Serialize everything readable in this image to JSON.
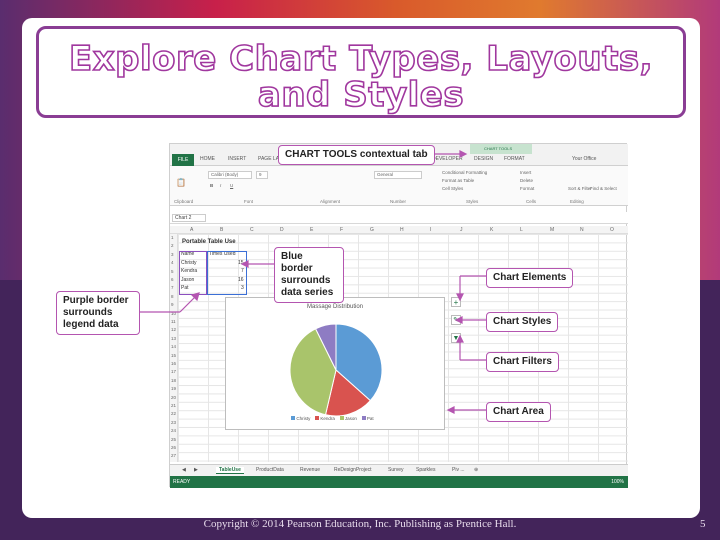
{
  "slide": {
    "title": "Explore Chart Types, Layouts, and Styles",
    "footer": "Copyright © 2014 Pearson Education, Inc. Publishing as Prentice Hall.",
    "page_number": "5"
  },
  "excel": {
    "ribbon_tabs": [
      "FILE",
      "HOME",
      "INSERT",
      "PAGE LAYOUT",
      "DEVELOPER",
      "DESIGN",
      "FORMAT"
    ],
    "chart_tools_label": "CHART TOOLS",
    "account": "Your Office",
    "font_name": "Calibri (Body)",
    "font_size": "9",
    "number_format": "General",
    "ribbon_items": [
      "Conditional Formatting",
      "Format as Table",
      "Cell Styles",
      "Insert",
      "Delete",
      "Format",
      "Sort & Filter",
      "Find & Select"
    ],
    "group_labels": [
      "Clipboard",
      "Font",
      "Alignment",
      "Number",
      "Styles",
      "Cells",
      "Editing"
    ],
    "name_box": "Chart 2",
    "columns": [
      "A",
      "B",
      "C",
      "D",
      "E",
      "F",
      "G",
      "H",
      "I",
      "J",
      "K",
      "L",
      "M",
      "N",
      "O"
    ],
    "rows": [
      "1",
      "2",
      "3",
      "4",
      "5",
      "6",
      "7",
      "8",
      "9",
      "10",
      "11",
      "12",
      "13",
      "14",
      "15",
      "16",
      "17",
      "18",
      "19",
      "20",
      "21",
      "22",
      "23",
      "24",
      "25",
      "26",
      "27"
    ],
    "table_title": "Portable Table Use",
    "headers": [
      "Name",
      "Times Used"
    ],
    "table_rows": [
      {
        "name": "Christy",
        "value": "15"
      },
      {
        "name": "Kendra",
        "value": "7"
      },
      {
        "name": "Jason",
        "value": "16"
      },
      {
        "name": "Pat",
        "value": "3"
      }
    ],
    "sheet_tabs": [
      "TableUse",
      "ProductData",
      "Revenue",
      "ReDesignProject",
      "Survey",
      "Sparkles",
      "Piv ..."
    ],
    "active_sheet": "TableUse",
    "status_left": "READY",
    "zoom": "100%"
  },
  "chart_data": {
    "type": "pie",
    "title": "Massage Distribution",
    "categories": [
      "Christy",
      "Kendra",
      "Jason",
      "Pat"
    ],
    "values": [
      15,
      7,
      16,
      3
    ],
    "colors": [
      "#5b9bd5",
      "#d9534f",
      "#a9c46b",
      "#8e7cc3"
    ],
    "legend_position": "bottom"
  },
  "callouts": {
    "chart_tools": "CHART TOOLS contextual tab",
    "blue_border": "Blue border surrounds data series",
    "purple_border": "Purple border surrounds legend data",
    "chart_elements": "Chart Elements",
    "chart_styles": "Chart Styles",
    "chart_filters": "Chart Filters",
    "chart_area": "Chart Area"
  }
}
